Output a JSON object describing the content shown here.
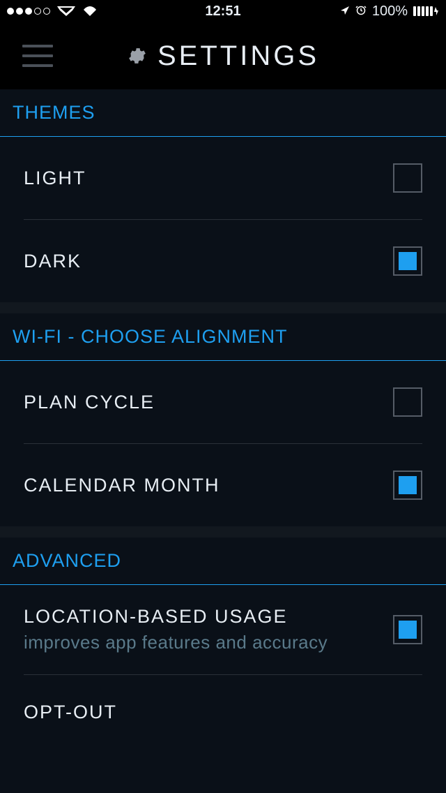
{
  "status": {
    "time": "12:51",
    "battery": "100%"
  },
  "header": {
    "title": "SETTINGS"
  },
  "sections": {
    "themes": {
      "title": "THEMES",
      "light": "LIGHT",
      "dark": "DARK"
    },
    "wifi": {
      "title": "WI-FI - CHOOSE ALIGNMENT",
      "plan_cycle": "PLAN CYCLE",
      "calendar_month": "CALENDAR MONTH"
    },
    "advanced": {
      "title": "ADVANCED",
      "location": "LOCATION-BASED USAGE",
      "location_sub": "improves app features and accuracy",
      "optout": "OPT-OUT"
    }
  }
}
